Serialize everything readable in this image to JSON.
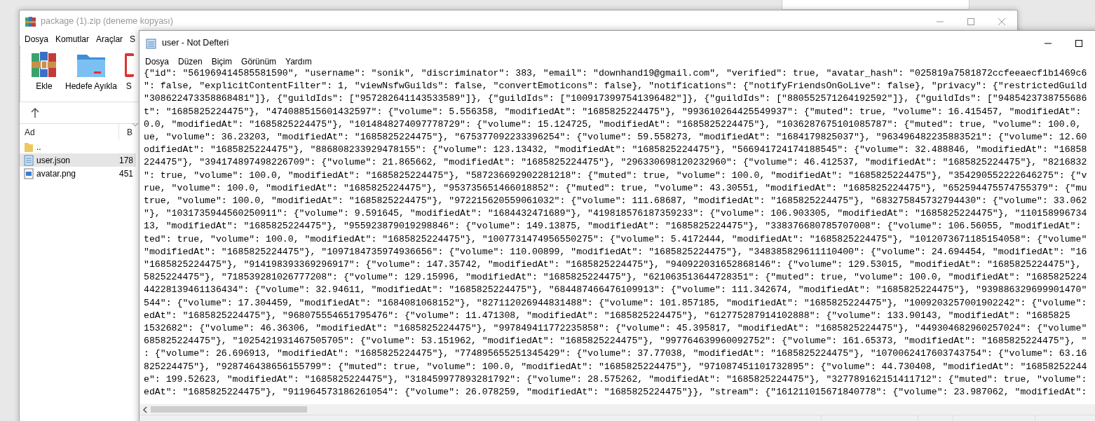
{
  "archive_window": {
    "title": "package (1).zip (deneme kopyası)",
    "menu": [
      "Dosya",
      "Komutlar",
      "Araçlar",
      "S"
    ],
    "toolbar": [
      {
        "label": "Ekle",
        "kind": "archive"
      },
      {
        "label": "Hedefe Ayıkla",
        "kind": "folder"
      },
      {
        "label": "S",
        "kind": "tool"
      }
    ],
    "columns": [
      "Ad",
      "B"
    ],
    "files": [
      {
        "name": "..",
        "kind": "folder",
        "selected": false
      },
      {
        "name": "user.json",
        "size": "178",
        "kind": "text",
        "selected": true
      },
      {
        "name": "avatar.png",
        "size": "451",
        "kind": "image",
        "selected": false
      }
    ]
  },
  "notepad": {
    "title": "user - Not Defteri",
    "menu": [
      "Dosya",
      "Düzen",
      "Biçim",
      "Görünüm",
      "Yardım"
    ],
    "lines": [
      "{\"id\": \"561969414585581590\", \"username\": \"sonik\", \"discriminator\": 383, \"email\": \"downhand19@gmail.com\", \"verified\": true, \"avatar_hash\": \"025819a7581872ccfeeaecf1b1469c6",
      "\": false, \"explicitContentFilter\": 1, \"viewNsfwGuilds\": false, \"convertEmoticons\": false}, \"notifications\": {\"notifyFriendsOnGoLive\": false}, \"privacy\": {\"restrictedGuild",
      "\"308622473358868481\"]}, {\"guildIds\": [\"957282641143533589\"]}, {\"guildIds\": [\"1009173997541396482\"]}, {\"guildIds\": [\"880552571264192592\"]}, {\"guildIds\": [\"9485423738755686",
      "t\": \"1685825224475\"}, \"474088515601432597\": {\"volume\": 5.556358, \"modifiedAt\": \"1685825224475\"}, \"993610264425549937\": {\"muted\": true, \"volume\": 16.415457, \"modifiedAt\":",
      "0.0, \"modifiedAt\": \"1685825224475\"}, \"1014848274097778729\": {\"volume\": 15.124725, \"modifiedAt\": \"1685825224475\"}, \"1036287675101085787\": {\"muted\": true, \"volume\": 100.0,",
      "ue, \"volume\": 36.23203, \"modifiedAt\": \"1685825224475\"}, \"675377092233396254\": {\"volume\": 59.558273, \"modifiedAt\": \"1684179825037\"}, \"963496482235883521\": {\"volume\": 12.60",
      "odifiedAt\": \"1685825224475\"}, \"886808233929478155\": {\"volume\": 123.13432, \"modifiedAt\": \"1685825224475\"}, \"566941724174188545\": {\"volume\": 32.488846, \"modifiedAt\": \"16858",
      "224475\"}, \"394174897498226709\": {\"volume\": 21.865662, \"modifiedAt\": \"1685825224475\"}, \"296330698120232960\": {\"volume\": 46.412537, \"modifiedAt\": \"1685825224475\"}, \"8216832",
      "\": true, \"volume\": 100.0, \"modifiedAt\": \"1685825224475\"}, \"587236692902281218\": {\"muted\": true, \"volume\": 100.0, \"modifiedAt\": \"1685825224475\"}, \"354290552222646275\": {\"v",
      "rue, \"volume\": 100.0, \"modifiedAt\": \"1685825224475\"}, \"953735651466018852\": {\"muted\": true, \"volume\": 43.30551, \"modifiedAt\": \"1685825224475\"}, \"652594475574755379\": {\"mu",
      "true, \"volume\": 100.0, \"modifiedAt\": \"1685825224475\"}, \"972215620559061032\": {\"volume\": 111.68687, \"modifiedAt\": \"1685825224475\"}, \"683275845732794430\": {\"volume\": 33.062",
      "\"}, \"1031735944560250911\": {\"volume\": 9.591645, \"modifiedAt\": \"1684432471689\"}, \"419818576187359233\": {\"volume\": 106.903305, \"modifiedAt\": \"1685825224475\"}, \"110158996734",
      "13, \"modifiedAt\": \"1685825224475\"}, \"955923879019298846\": {\"volume\": 149.13875, \"modifiedAt\": \"1685825224475\"}, \"338376680785707008\": {\"volume\": 106.56055, \"modifiedAt\":",
      "ted\": true, \"volume\": 100.0, \"modifiedAt\": \"1685825224475\"}, \"1007731474956550275\": {\"volume\": 5.4172444, \"modifiedAt\": \"1685825224475\"}, \"1012073671185154058\": {\"volume\"",
      "\"modifiedAt\": \"1685825224475\"}, \"1097184735974936656\": {\"volume\": 110.00899, \"modifiedAt\": \"1685825224475\"}, \"348385829611110400\": {\"volume\": 24.694454, \"modifiedAt\": \"16",
      "\"1685825224475\"}, \"914198393369296917\": {\"volume\": 147.35742, \"modifiedAt\": \"1685825224475\"}, \"940922031652868146\": {\"volume\": 129.53015, \"modifiedAt\": \"1685825224475\"},",
      "5825224475\"}, \"718539281026777208\": {\"volume\": 129.15996, \"modifiedAt\": \"1685825224475\"}, \"621063513644728351\": {\"muted\": true, \"volume\": 100.0, \"modifiedAt\": \"1685825224",
      "44228139461136434\": {\"volume\": 32.94611, \"modifiedAt\": \"1685825224475\"}, \"684487466476109913\": {\"volume\": 111.342674, \"modifiedAt\": \"1685825224475\"}, \"939886329699901470\"",
      "544\": {\"volume\": 17.304459, \"modifiedAt\": \"1684081068152\"}, \"827112026944831488\": {\"volume\": 101.857185, \"modifiedAt\": \"1685825224475\"}, \"1009203257001902242\": {\"volume\":",
      "edAt\": \"1685825224475\"}, \"968075554651795476\": {\"volume\": 11.471308, \"modifiedAt\": \"1685825224475\"}, \"612775287914102888\": {\"volume\": 133.90143, \"modifiedAt\": \"1685825",
      "1532682\": {\"volume\": 46.36306, \"modifiedAt\": \"1685825224475\"}, \"997849411772235858\": {\"volume\": 45.395817, \"modifiedAt\": \"1685825224475\"}, \"449304682960257024\": {\"volume\"",
      "685825224475\"}, \"1025421931467505705\": {\"volume\": 53.151962, \"modifiedAt\": \"1685825224475\"}, \"997764639960092752\": {\"volume\": 161.65373, \"modifiedAt\": \"1685825224475\"}, \"",
      ": {\"volume\": 26.696913, \"modifiedAt\": \"1685825224475\"}, \"774895655251345429\": {\"volume\": 37.77038, \"modifiedAt\": \"1685825224475\"}, \"1070062417603743754\": {\"volume\": 63.16",
      "825224475\"}, \"928746438656155799\": {\"muted\": true, \"volume\": 100.0, \"modifiedAt\": \"1685825224475\"}, \"971087451101732895\": {\"volume\": 44.730408, \"modifiedAt\": \"16858252244",
      "e\": 199.52623, \"modifiedAt\": \"1685825224475\"}, \"318459977893281792\": {\"volume\": 28.575262, \"modifiedAt\": \"1685825224475\"}, \"327789162151411712\": {\"muted\": true, \"volume\":",
      "edAt\": \"1685825224475\"}, \"911964573186261054\": {\"volume\": 26.078259, \"modifiedAt\": \"1685825224475\"}}, \"stream\": {\"161211015671840778\": {\"volume\": 23.987062, \"modifiedAt\":"
    ]
  }
}
